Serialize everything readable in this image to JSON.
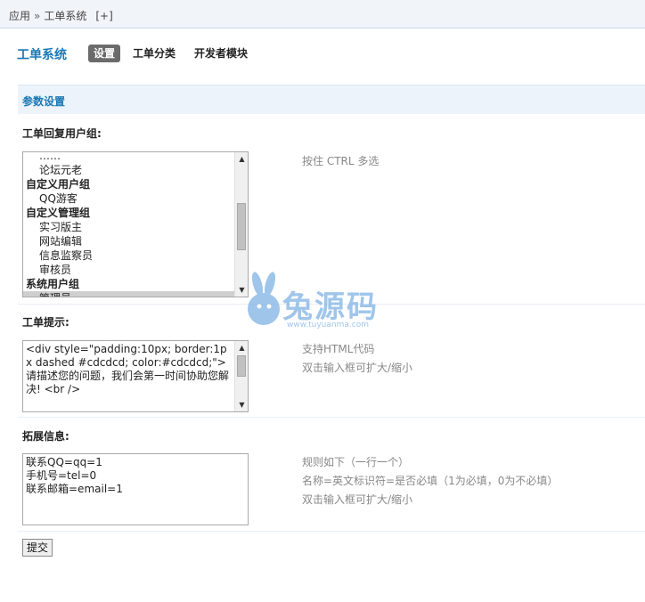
{
  "breadcrumb": {
    "root": "应用",
    "separator": "»",
    "current": "工单系统",
    "toggle": "[+]"
  },
  "nav": {
    "title": "工单系统",
    "tabs": [
      {
        "label": "设置",
        "active": true
      },
      {
        "label": "工单分类",
        "active": false
      },
      {
        "label": "开发者模块",
        "active": false
      }
    ]
  },
  "section": {
    "title": "参数设置"
  },
  "reply_group": {
    "label": "工单回复用户组:",
    "hint": "按住 CTRL 多选",
    "options": [
      {
        "text": "……",
        "type": "child",
        "selected": false
      },
      {
        "text": "论坛元老",
        "type": "child",
        "selected": false
      },
      {
        "text": "自定义用户组",
        "type": "group",
        "selected": false
      },
      {
        "text": "QQ游客",
        "type": "child",
        "selected": false
      },
      {
        "text": "自定义管理组",
        "type": "group",
        "selected": false
      },
      {
        "text": "实习版主",
        "type": "child",
        "selected": false
      },
      {
        "text": "网站编辑",
        "type": "child",
        "selected": false
      },
      {
        "text": "信息监察员",
        "type": "child",
        "selected": false
      },
      {
        "text": "审核员",
        "type": "child",
        "selected": false
      },
      {
        "text": "系统用户组",
        "type": "group",
        "selected": false
      },
      {
        "text": "管理员",
        "type": "child",
        "selected": true
      }
    ]
  },
  "notice": {
    "label": "工单提示:",
    "value": "<div style=\"padding:10px; border:1px dashed #cdcdcd; color:#cdcdcd;\">\n请描述您的问题，我们会第一时间协助您解决! <br />",
    "hints": [
      "支持HTML代码",
      "双击输入框可扩大/缩小"
    ]
  },
  "extra": {
    "label": "拓展信息:",
    "value": "联系QQ=qq=1\n手机号=tel=0\n联系邮箱=email=1",
    "hints": [
      "规则如下（一行一个）",
      "名称=英文标识符=是否必填（1为必填，0为不必填）",
      "双击输入框可扩大/缩小"
    ]
  },
  "submit": {
    "label": "提交"
  },
  "watermark": {
    "brand": "兔源码",
    "url": "www.tuyuanma.com"
  }
}
